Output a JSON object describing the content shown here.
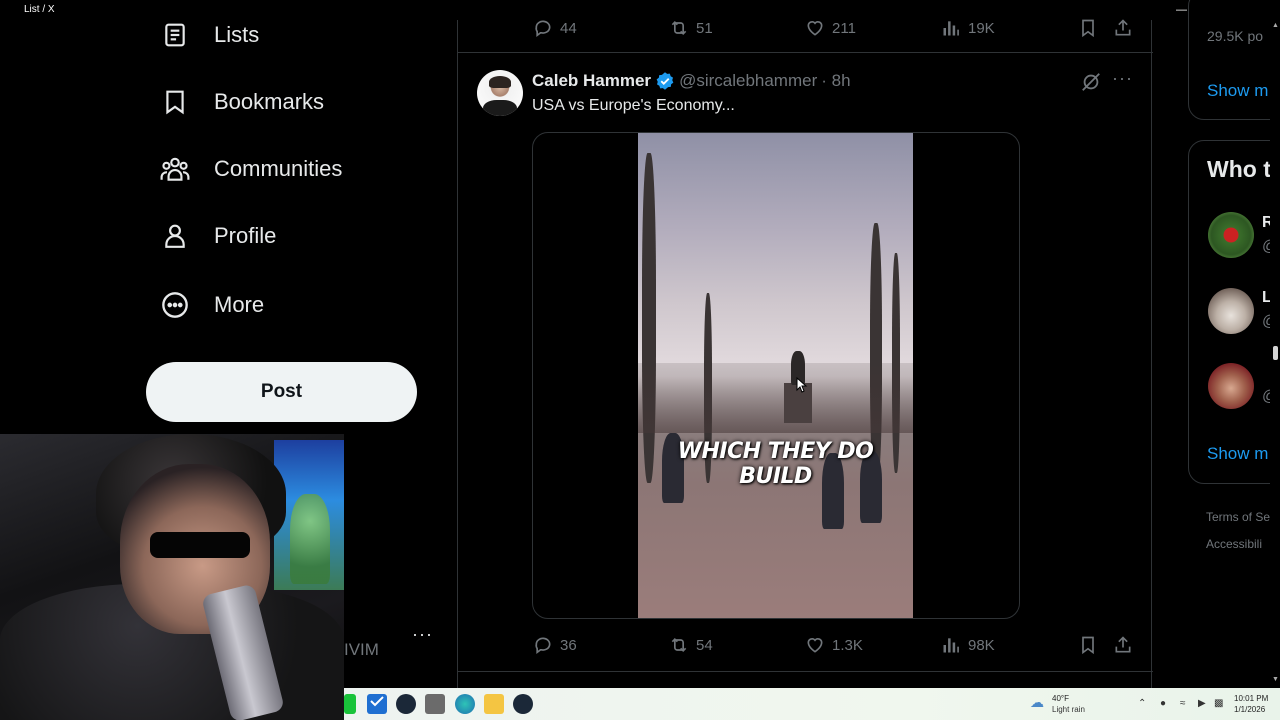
{
  "window": {
    "title": "List / X"
  },
  "nav": {
    "items": [
      {
        "label": "Lists",
        "icon": "list-icon"
      },
      {
        "label": "Bookmarks",
        "icon": "bookmark-icon"
      },
      {
        "label": "Communities",
        "icon": "communities-icon"
      },
      {
        "label": "Profile",
        "icon": "profile-icon"
      },
      {
        "label": "More",
        "icon": "more-circle-icon"
      }
    ],
    "post_label": "Post",
    "account_partial": "IVIM",
    "account_more": "···"
  },
  "prev_tweet": {
    "replies": "44",
    "reposts": "51",
    "likes": "211",
    "views": "19K"
  },
  "tweet": {
    "author_name": "Caleb Hammer",
    "author_handle": "@sircalebhammer",
    "time": "· 8h",
    "text": "USA vs Europe's Economy...",
    "video_caption": "WHICH THEY DO BUILD",
    "more": "···",
    "replies": "36",
    "reposts": "54",
    "likes": "1.3K",
    "views": "98K"
  },
  "sidebar": {
    "posts_count": "29.5K po",
    "show_more_1": "Show m",
    "who_to_follow": "Who t",
    "suggestions": [
      {
        "initial": "R",
        "sub": "@"
      },
      {
        "initial": "L",
        "sub": "@"
      },
      {
        "initial": "",
        "sub": "@"
      }
    ],
    "show_more_2": "Show m",
    "footer": [
      "Terms of Se",
      "Accessibili"
    ]
  },
  "taskbar": {
    "weather_temp": "40°F",
    "weather_desc": "Light rain",
    "time": "10:01 PM",
    "date": "1/1/2026"
  },
  "colors": {
    "accent": "#1d9bf0",
    "background": "#000000",
    "muted": "#71767b",
    "text": "#e7e9ea",
    "post_button": "#eff3f4"
  }
}
